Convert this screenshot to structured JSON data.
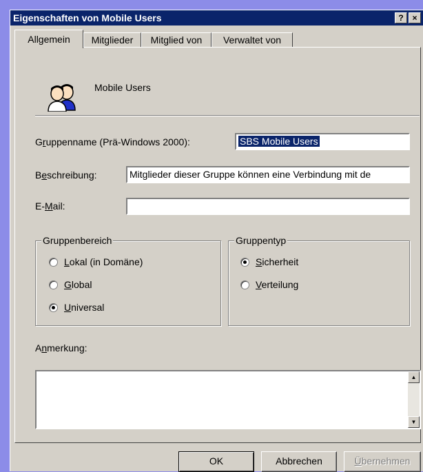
{
  "window": {
    "title": "Eigenschaften von Mobile Users",
    "help_label": "?",
    "close_label": "×"
  },
  "tabs": [
    {
      "label": "Allgemein",
      "active": true
    },
    {
      "label": "Mitglieder",
      "active": false
    },
    {
      "label": "Mitglied von",
      "active": false
    },
    {
      "label": "Verwaltet von",
      "active": false
    }
  ],
  "header": {
    "icon": "group-users-icon",
    "name": "Mobile Users"
  },
  "form": {
    "groupname_label_pre": "G",
    "groupname_label_ul": "r",
    "groupname_label_post": "uppenname (Prä-Windows 2000):",
    "groupname_value": "SBS Mobile Users",
    "description_label_pre": "B",
    "description_label_ul": "e",
    "description_label_post": "schreibung:",
    "description_value": "Mitglieder dieser Gruppe können eine Verbindung mit de",
    "email_label_pre": "E-",
    "email_label_ul": "M",
    "email_label_post": "ail:",
    "email_value": ""
  },
  "scope": {
    "legend": "Gruppenbereich",
    "options": [
      {
        "ul": "L",
        "rest": "okal (in Domäne)",
        "checked": false
      },
      {
        "ul": "G",
        "rest": "lobal",
        "checked": false
      },
      {
        "ul": "U",
        "rest": "niversal",
        "checked": true
      }
    ]
  },
  "type": {
    "legend": "Gruppentyp",
    "options": [
      {
        "ul": "S",
        "rest": "icherheit",
        "checked": true
      },
      {
        "ul": "V",
        "rest": "erteilung",
        "checked": false
      }
    ]
  },
  "notes": {
    "label_pre": "A",
    "label_ul": "n",
    "label_post": "merkung:",
    "value": ""
  },
  "buttons": {
    "ok": "OK",
    "cancel": "Abbrechen",
    "apply_ul": "Ü",
    "apply_rest": "bernehmen"
  },
  "colors": {
    "desktop": "#8c8ce8",
    "titlebar": "#0a246a",
    "face": "#d4d0c8",
    "selection": "#0a246a"
  }
}
